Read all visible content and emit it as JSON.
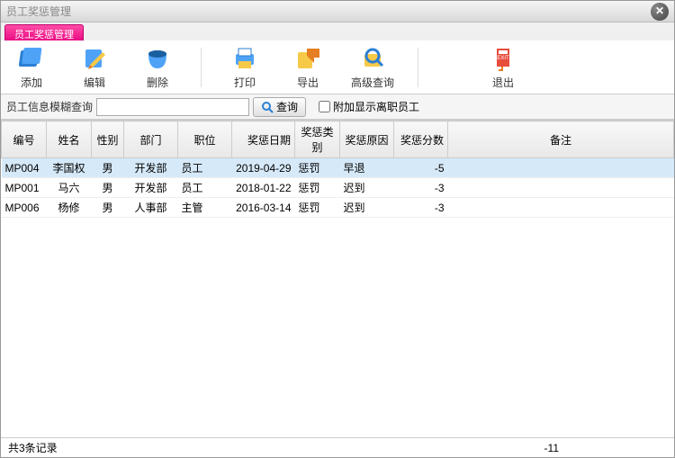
{
  "window": {
    "title": "员工奖惩管理"
  },
  "tab": {
    "label": "员工奖惩管理"
  },
  "toolbar": {
    "add": "添加",
    "edit": "编辑",
    "delete": "删除",
    "print": "打印",
    "export": "导出",
    "advanced_query": "高级查询",
    "exit": "退出"
  },
  "search": {
    "label": "员工信息模糊查询",
    "value": "",
    "button": "查询",
    "checkbox_label": "附加显示离职员工",
    "checkbox_checked": false
  },
  "table": {
    "headers": {
      "id": "编号",
      "name": "姓名",
      "gender": "性别",
      "dept": "部门",
      "position": "职位",
      "date": "奖惩日期",
      "type": "奖惩类别",
      "reason": "奖惩原因",
      "score": "奖惩分数",
      "note": "备注"
    },
    "rows": [
      {
        "id": "MP004",
        "name": "李国权",
        "gender": "男",
        "dept": "开发部",
        "position": "员工",
        "date": "2019-04-29",
        "type": "惩罚",
        "reason": "早退",
        "score": "-5",
        "note": "",
        "selected": true
      },
      {
        "id": "MP001",
        "name": "马六",
        "gender": "男",
        "dept": "开发部",
        "position": "员工",
        "date": "2018-01-22",
        "type": "惩罚",
        "reason": "迟到",
        "score": "-3",
        "note": "",
        "selected": false
      },
      {
        "id": "MP006",
        "name": "杨修",
        "gender": "男",
        "dept": "人事部",
        "position": "主管",
        "date": "2016-03-14",
        "type": "惩罚",
        "reason": "迟到",
        "score": "-3",
        "note": "",
        "selected": false
      }
    ]
  },
  "status": {
    "record_count": "共3条记录",
    "total": "-11"
  }
}
